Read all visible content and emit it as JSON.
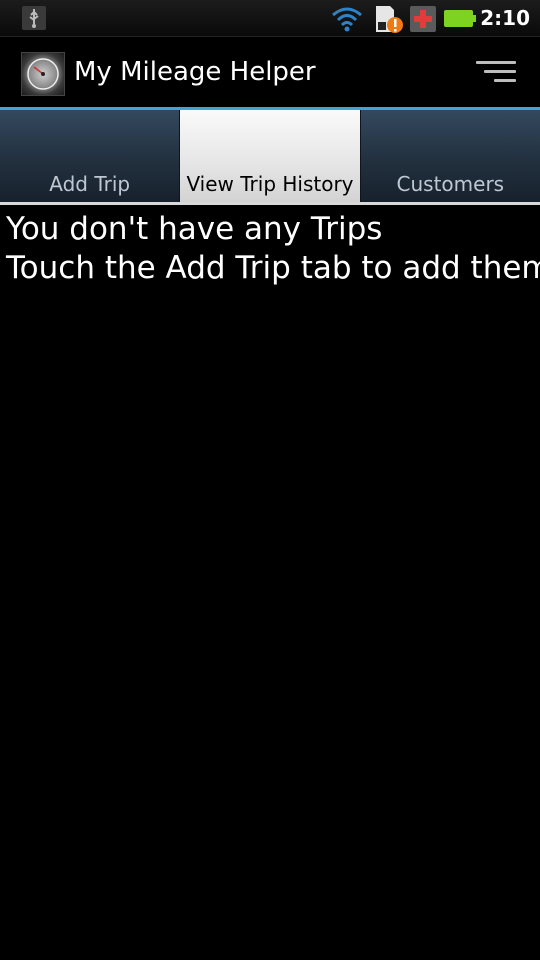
{
  "status_bar": {
    "time": "2:10",
    "icons": [
      "usb-icon",
      "wifi-icon",
      "sd-card-warning-icon",
      "medical-app-icon",
      "battery-icon"
    ],
    "accent": "#3fa5d7",
    "battery_color": "#7ed321"
  },
  "app": {
    "title": "My Mileage Helper",
    "icon": "speedometer-icon"
  },
  "tabs": [
    {
      "label": "Add Trip",
      "selected": false
    },
    {
      "label": "View Trip History",
      "selected": true
    },
    {
      "label": "Customers",
      "selected": false
    }
  ],
  "content": {
    "line1": "You don't have any Trips",
    "line2": "Touch the Add Trip tab to add them"
  }
}
